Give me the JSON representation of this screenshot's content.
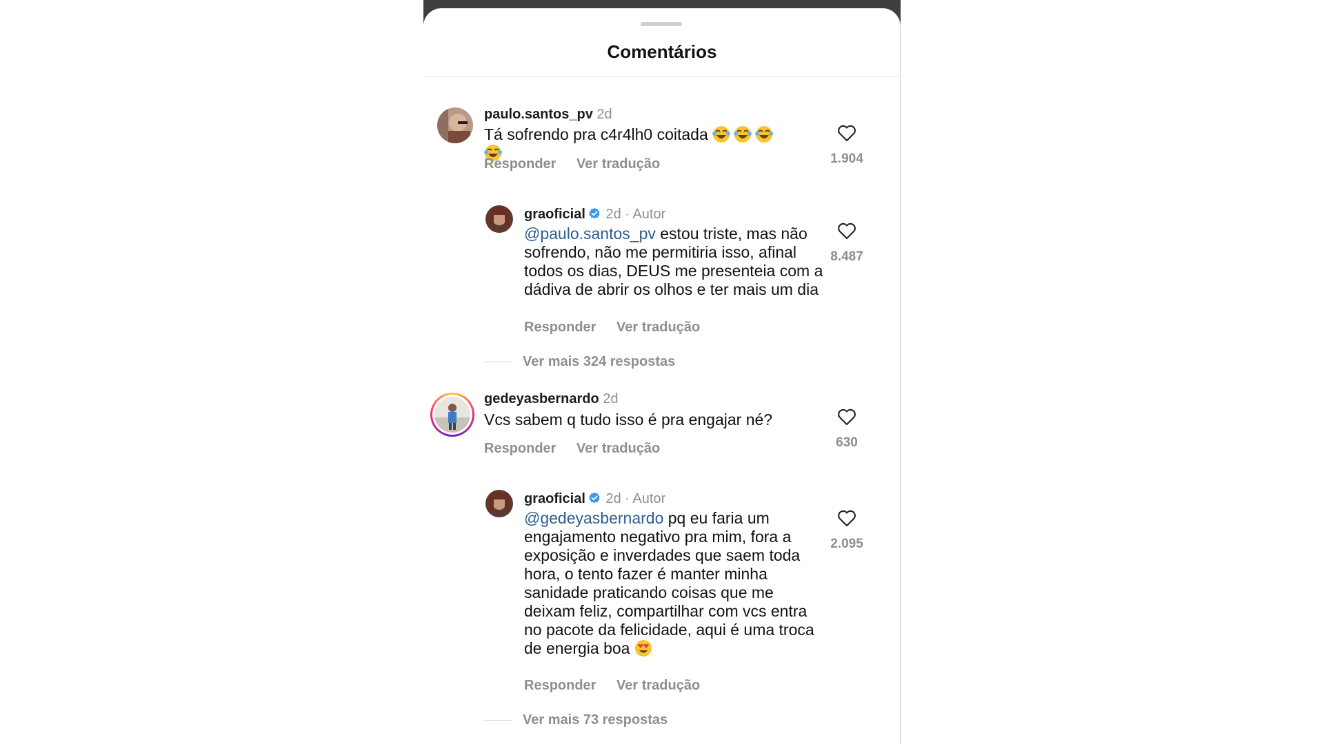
{
  "sheet": {
    "title": "Comentários"
  },
  "comments": [
    {
      "username": "paulo.santos_pv",
      "time": "2d",
      "text": "Tá sofrendo pra c4r4lh0 coitada",
      "emoji_count": 4,
      "reply_label": "Responder",
      "translate_label": "Ver tradução",
      "likes": "1.904",
      "reply": {
        "username": "graoficial",
        "time": "2d",
        "separator": "·",
        "author_badge": "Autor",
        "mention": "@paulo.santos_pv",
        "text": " estou triste, mas não sofrendo, não me permitiria isso, afinal todos os dias, DEUS me presenteia com a dádiva de abrir os olhos e ter mais um dia",
        "reply_label": "Responder",
        "translate_label": "Ver tradução",
        "likes": "8.487"
      },
      "more_replies": "Ver mais 324 respostas"
    },
    {
      "username": "gedeyasbernardo",
      "time": "2d",
      "text": "Vcs sabem q tudo isso é pra engajar né?",
      "reply_label": "Responder",
      "translate_label": "Ver tradução",
      "likes": "630",
      "reply": {
        "username": "graoficial",
        "time": "2d",
        "separator": "·",
        "author_badge": "Autor",
        "mention": "@gedeyasbernardo",
        "text": " pq eu faria um engajamento negativo pra mim, fora a exposição e inverdades que saem toda hora, o tento fazer é manter minha sanidade praticando coisas que me deixam feliz, compartilhar com vcs entra no pacote da felicidade, aqui é uma troca de energia boa",
        "reply_label": "Responder",
        "translate_label": "Ver tradução",
        "likes": "2.095"
      },
      "more_replies": "Ver mais 73 respostas"
    }
  ],
  "icons": {
    "like": "heart-outline-icon",
    "verified": "verified-badge-icon"
  },
  "colors": {
    "mention": "#2d5d92",
    "verified": "#3897f0",
    "muted": "#8e8e8e"
  }
}
